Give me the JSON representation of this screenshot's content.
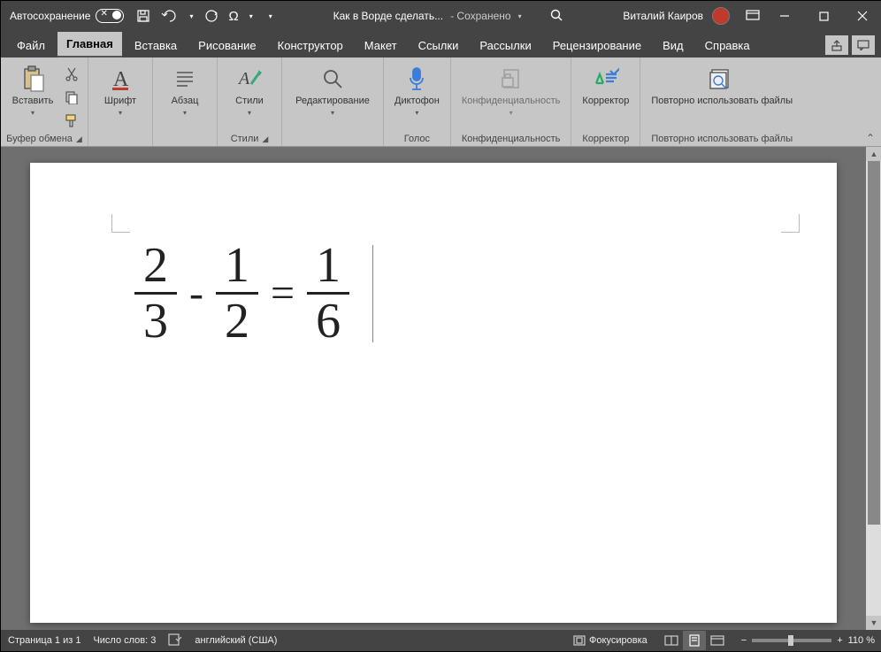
{
  "titlebar": {
    "autosave_label": "Автосохранение",
    "doc_title": "Как в Ворде сделать...",
    "saved_status": "- Сохранено",
    "user_name": "Виталий Каиров"
  },
  "tabs": {
    "file": "Файл",
    "home": "Главная",
    "insert": "Вставка",
    "draw": "Рисование",
    "design": "Конструктор",
    "layout": "Макет",
    "references": "Ссылки",
    "mailings": "Рассылки",
    "review": "Рецензирование",
    "view": "Вид",
    "help": "Справка"
  },
  "ribbon": {
    "paste": "Вставить",
    "font": "Шрифт",
    "paragraph": "Абзац",
    "styles": "Стили",
    "editing": "Редактирование",
    "dictate": "Диктофон",
    "sensitivity": "Конфиденциаль­ность",
    "editor": "Корректор",
    "reuse": "Повторно использовать файлы",
    "g_clipboard": "Буфер обмена",
    "g_styles": "Стили",
    "g_voice": "Голос",
    "g_sensitivity": "Конфиденциальность",
    "g_editor": "Корректор",
    "g_reuse": "Повторно использовать файлы"
  },
  "document": {
    "equation": {
      "f1": {
        "num": "2",
        "den": "3"
      },
      "op1": "-",
      "f2": {
        "num": "1",
        "den": "2"
      },
      "op2": "=",
      "f3": {
        "num": "1",
        "den": "6"
      }
    }
  },
  "statusbar": {
    "page": "Страница 1 из 1",
    "words": "Число слов: 3",
    "language": "английский (США)",
    "focus": "Фокусировка",
    "zoom": "110 %"
  }
}
